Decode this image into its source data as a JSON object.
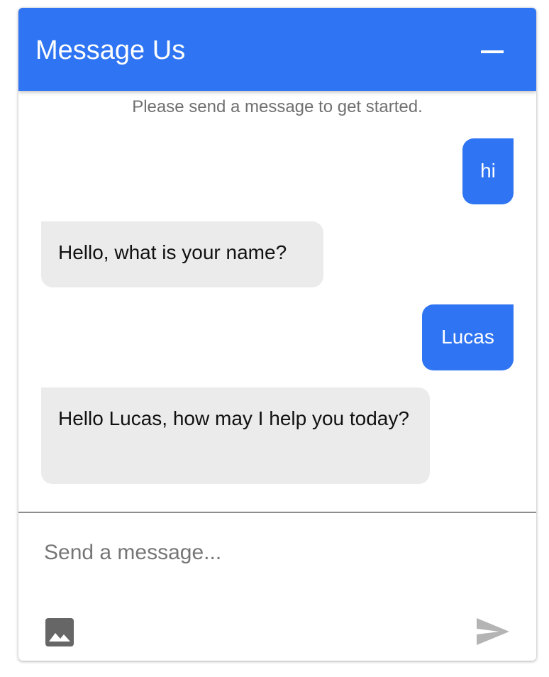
{
  "header": {
    "title": "Message Us",
    "minimize_icon": "minus-icon"
  },
  "conversation": {
    "hint": "Please send a message to get started.",
    "messages": [
      {
        "sender": "user",
        "text": "hi"
      },
      {
        "sender": "bot",
        "text": "Hello, what is your name?"
      },
      {
        "sender": "user",
        "text": "Lucas"
      },
      {
        "sender": "bot",
        "text": "Hello Lucas, how may I help you today?"
      }
    ]
  },
  "composer": {
    "placeholder": "Send a message...",
    "value": "",
    "attach_icon": "image-icon",
    "send_icon": "send-icon"
  },
  "colors": {
    "accent": "#2f74f2",
    "bot_bubble": "#ebebeb",
    "hint_text": "#707070",
    "send_disabled": "#b4b4b4",
    "image_icon": "#666666"
  }
}
